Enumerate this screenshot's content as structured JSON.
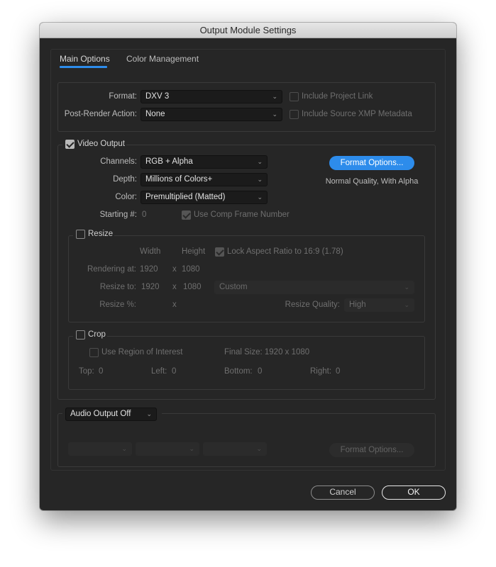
{
  "window": {
    "title": "Output Module Settings"
  },
  "tabs": [
    {
      "label": "Main Options",
      "active": true
    },
    {
      "label": "Color Management",
      "active": false
    }
  ],
  "format_section": {
    "format_label": "Format:",
    "format_value": "DXV 3",
    "post_render_label": "Post-Render Action:",
    "post_render_value": "None",
    "include_project_link": {
      "label": "Include Project Link",
      "checked": false,
      "enabled": false
    },
    "include_xmp": {
      "label": "Include Source XMP Metadata",
      "checked": false,
      "enabled": false
    }
  },
  "video_output": {
    "label": "Video Output",
    "checked": true,
    "channels_label": "Channels:",
    "channels_value": "RGB + Alpha",
    "depth_label": "Depth:",
    "depth_value": "Millions of Colors+",
    "color_label": "Color:",
    "color_value": "Premultiplied (Matted)",
    "starting_label": "Starting #:",
    "starting_value": "0",
    "use_comp_frame": {
      "label": "Use Comp Frame Number",
      "checked": true,
      "enabled": false
    },
    "format_options_label": "Format Options...",
    "format_summary": "Normal Quality, With Alpha"
  },
  "resize": {
    "label": "Resize",
    "checked": false,
    "width_header": "Width",
    "height_header": "Height",
    "lock_aspect": {
      "label": "Lock Aspect Ratio to 16:9 (1.78)",
      "checked": true,
      "enabled": false
    },
    "rendering_at_label": "Rendering at:",
    "rendering_width": "1920",
    "rendering_x": "x",
    "rendering_height": "1080",
    "resize_to_label": "Resize to:",
    "resize_width": "1920",
    "resize_x": "x",
    "resize_height": "1080",
    "preset_value": "Custom",
    "resize_pct_label": "Resize %:",
    "resize_pct_x": "x",
    "quality_label": "Resize Quality:",
    "quality_value": "High"
  },
  "crop": {
    "label": "Crop",
    "checked": false,
    "use_roi": {
      "label": "Use Region of Interest",
      "checked": false,
      "enabled": false
    },
    "final_size": "Final Size: 1920 x 1080",
    "top_label": "Top:",
    "top_value": "0",
    "left_label": "Left:",
    "left_value": "0",
    "bottom_label": "Bottom:",
    "bottom_value": "0",
    "right_label": "Right:",
    "right_value": "0"
  },
  "audio": {
    "mode_value": "Audio Output Off",
    "format_options_label": "Format Options..."
  },
  "footer": {
    "cancel_label": "Cancel",
    "ok_label": "OK"
  },
  "colors": {
    "accent": "#2d8ceb",
    "background": "#262626"
  }
}
